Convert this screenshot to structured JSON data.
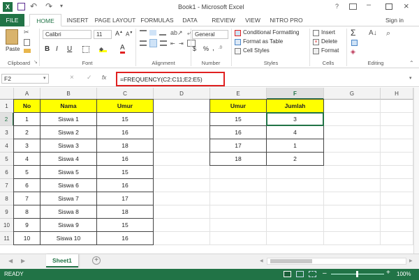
{
  "window": {
    "title": "Book1 - Microsoft Excel",
    "sign_in": "Sign in",
    "help": "?"
  },
  "tabs": [
    "FILE",
    "HOME",
    "INSERT",
    "PAGE LAYOUT",
    "FORMULAS",
    "DATA",
    "REVIEW",
    "VIEW",
    "NITRO PRO"
  ],
  "ribbon": {
    "paste": "Paste",
    "clipboard_label": "Clipboard",
    "font_name": "Calibri",
    "font_size": "11",
    "font_label": "Font",
    "alignment_label": "Alignment",
    "number_format": "General",
    "number_label": "Number",
    "conditional_formatting": "Conditional Formatting",
    "format_as_table": "Format as Table",
    "cell_styles": "Cell Styles",
    "styles_label": "Styles",
    "insert": "Insert",
    "delete": "Delete",
    "format": "Format",
    "cells_label": "Cells",
    "editing_label": "Editing",
    "bold": "B",
    "italic": "I",
    "underline": "U",
    "font_color_letter": "A",
    "currency": "$",
    "percent": "%",
    "comma": ",",
    "sigma": "Σ"
  },
  "formula_bar": {
    "name_box": "F2",
    "fx": "fx",
    "formula": "=FREQUENCY(C2:C11;E2:E5)"
  },
  "columns": [
    "A",
    "B",
    "C",
    "D",
    "E",
    "F",
    "G",
    "H"
  ],
  "rows": [
    "1",
    "2",
    "3",
    "4",
    "5",
    "6",
    "7",
    "8",
    "9",
    "10",
    "11"
  ],
  "table1": {
    "headers": [
      "No",
      "Nama",
      "Umur"
    ],
    "rows": [
      [
        "1",
        "Siswa 1",
        "15"
      ],
      [
        "2",
        "Siswa 2",
        "16"
      ],
      [
        "3",
        "Siswa 3",
        "18"
      ],
      [
        "4",
        "Siswa 4",
        "16"
      ],
      [
        "5",
        "Siswa 5",
        "15"
      ],
      [
        "6",
        "Siswa 6",
        "16"
      ],
      [
        "7",
        "Siswa 7",
        "17"
      ],
      [
        "8",
        "Siswa 8",
        "18"
      ],
      [
        "9",
        "Siswa 9",
        "15"
      ],
      [
        "10",
        "Siswa 10",
        "16"
      ]
    ]
  },
  "table2": {
    "headers": [
      "Umur",
      "Jumlah"
    ],
    "rows": [
      [
        "15",
        "3"
      ],
      [
        "16",
        "4"
      ],
      [
        "17",
        "1"
      ],
      [
        "18",
        "2"
      ]
    ]
  },
  "sheet_tab": "Sheet1",
  "status": {
    "ready": "READY",
    "zoom": "100%"
  },
  "colors": {
    "excel_green": "#217346",
    "highlight": "#ffff00",
    "formula_box": "#e02020"
  }
}
